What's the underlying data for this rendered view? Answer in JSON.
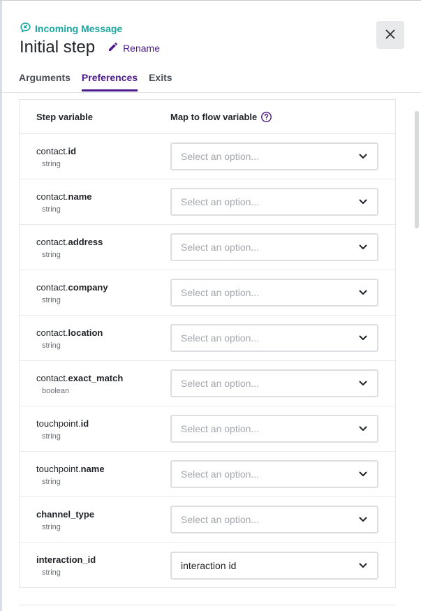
{
  "header": {
    "step_type": "Incoming Message",
    "step_type_icon": "incoming-message-icon",
    "title": "Initial step",
    "rename_label": "Rename",
    "rename_icon": "pencil-icon",
    "close_icon": "close-icon"
  },
  "colors": {
    "accent": "#4b1a8c",
    "step_type": "#1aa6a0"
  },
  "tabs": [
    {
      "label": "Arguments",
      "active": false
    },
    {
      "label": "Preferences",
      "active": true
    },
    {
      "label": "Exits",
      "active": false
    }
  ],
  "table": {
    "col_step_variable": "Step variable",
    "col_map_to_flow": "Map to flow variable",
    "help_icon": "help-circle-icon",
    "rows": [
      {
        "prefix": "contact.",
        "name": "id",
        "type": "string",
        "value": "",
        "placeholder": "Select an option..."
      },
      {
        "prefix": "contact.",
        "name": "name",
        "type": "string",
        "value": "",
        "placeholder": "Select an option..."
      },
      {
        "prefix": "contact.",
        "name": "address",
        "type": "string",
        "value": "",
        "placeholder": "Select an option..."
      },
      {
        "prefix": "contact.",
        "name": "company",
        "type": "string",
        "value": "",
        "placeholder": "Select an option..."
      },
      {
        "prefix": "contact.",
        "name": "location",
        "type": "string",
        "value": "",
        "placeholder": "Select an option..."
      },
      {
        "prefix": "contact.",
        "name": "exact_match",
        "type": "boolean",
        "value": "",
        "placeholder": "Select an option..."
      },
      {
        "prefix": "touchpoint.",
        "name": "id",
        "type": "string",
        "value": "",
        "placeholder": "Select an option..."
      },
      {
        "prefix": "touchpoint.",
        "name": "name",
        "type": "string",
        "value": "",
        "placeholder": "Select an option..."
      },
      {
        "prefix": "",
        "name": "channel_type",
        "type": "string",
        "value": "",
        "placeholder": "Select an option..."
      },
      {
        "prefix": "",
        "name": "interaction_id",
        "type": "string",
        "value": "interaction id",
        "placeholder": "Select an option..."
      }
    ]
  }
}
